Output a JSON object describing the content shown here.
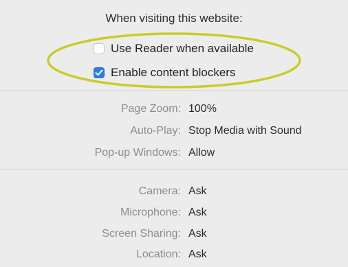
{
  "heading": "When visiting this website:",
  "options": [
    {
      "label": "Use Reader when available",
      "checked": false
    },
    {
      "label": "Enable content blockers",
      "checked": true
    }
  ],
  "section1": [
    {
      "label": "Page Zoom:",
      "value": "100%"
    },
    {
      "label": "Auto-Play:",
      "value": "Stop Media with Sound"
    },
    {
      "label": "Pop-up Windows:",
      "value": "Allow"
    }
  ],
  "section2": [
    {
      "label": "Camera:",
      "value": "Ask"
    },
    {
      "label": "Microphone:",
      "value": "Ask"
    },
    {
      "label": "Screen Sharing:",
      "value": "Ask"
    },
    {
      "label": "Location:",
      "value": "Ask"
    }
  ],
  "colors": {
    "highlight_ring": "#c9cc2a",
    "checkbox_checked": "#2f7de1",
    "label_gray": "#8c8c8c"
  }
}
